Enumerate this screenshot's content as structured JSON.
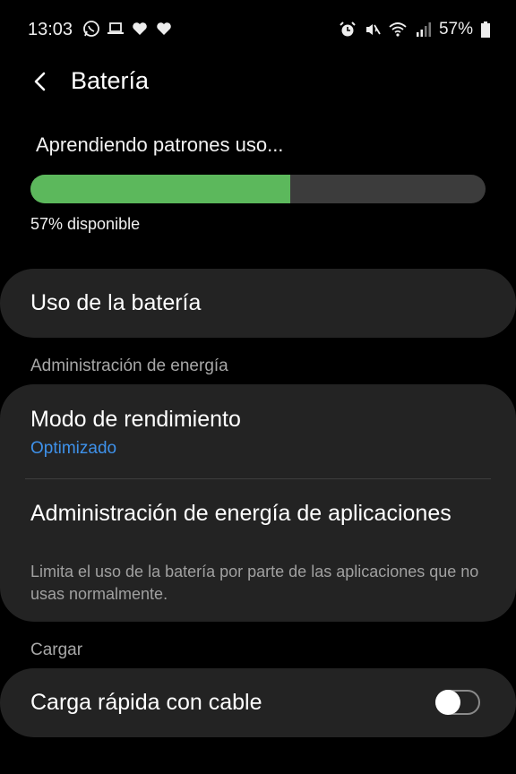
{
  "status_bar": {
    "time": "13:03",
    "battery_percent": "57%",
    "icons_left": [
      "whatsapp-icon",
      "laptop-icon",
      "heart-icon",
      "heart-icon"
    ],
    "icons_right": [
      "alarm-icon",
      "mute-icon",
      "wifi-icon",
      "signal-icon",
      "battery-icon"
    ]
  },
  "header": {
    "title": "Batería"
  },
  "battery": {
    "learning_text": "Aprendiendo patrones uso...",
    "level_percent": 57,
    "available_text": "57% disponible",
    "bar_color": "#5cb85c"
  },
  "items": {
    "battery_usage": "Uso de la batería"
  },
  "sections": {
    "power_management": "Administración de energía",
    "charging": "Cargar"
  },
  "power": {
    "performance_mode_title": "Modo de rendimiento",
    "performance_mode_value": "Optimizado",
    "app_power_title": "Administración de energía de aplicaciones",
    "app_power_desc": "Limita el uso de la batería por parte de las aplicaciones que no usas normalmente."
  },
  "charging": {
    "fast_cable_label": "Carga rápida con cable",
    "fast_cable_enabled": false
  },
  "colors": {
    "accent": "#3e91ea",
    "card_bg": "#232323"
  }
}
